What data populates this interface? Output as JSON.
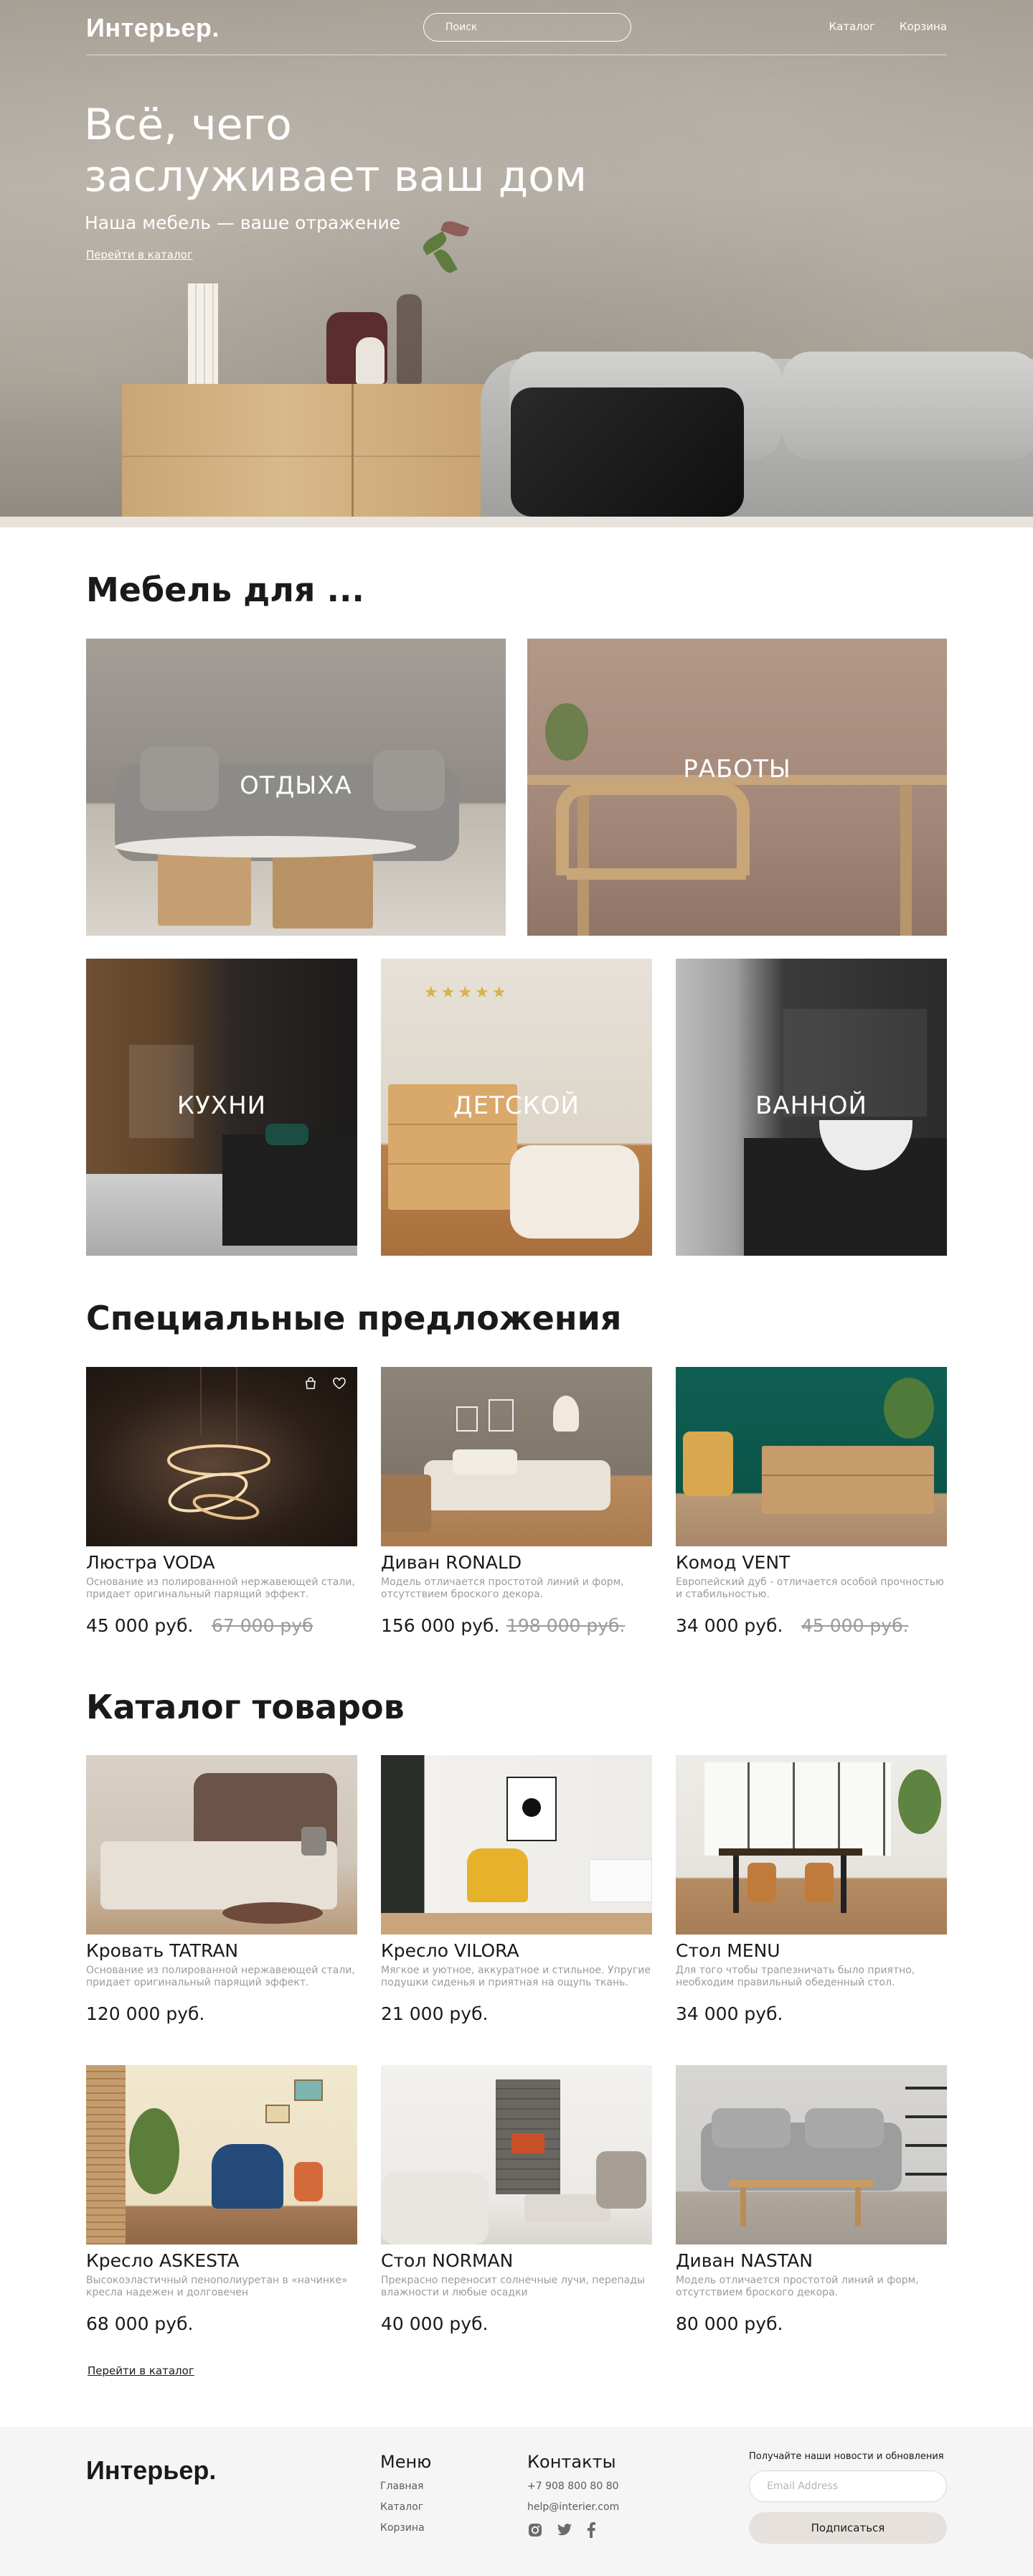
{
  "header": {
    "logo": "Интерьер.",
    "search_placeholder": "Поиск",
    "nav": [
      "Каталог",
      "Корзина"
    ]
  },
  "hero": {
    "title_line1": "Всё, чего",
    "title_line2": "заслуживает ваш дом",
    "subtitle": "Наша мебель — ваше отражение",
    "link": "Перейти в каталог"
  },
  "categories": {
    "title": "Мебель для ...",
    "items": [
      "ОТДЫХА",
      "РАБОТЫ",
      "КУХНИ",
      "ДЕТСКОЙ",
      "ВАННОЙ"
    ]
  },
  "specials": {
    "title": "Специальные предложения",
    "items": [
      {
        "name": "Люстра VODA",
        "desc": "Основание из полированной нержавеющей стали, придает оригинальный парящий эффект.",
        "price": "45 000 руб.",
        "old_price": "67 000 руб"
      },
      {
        "name": "Диван RONALD",
        "desc": "Модель отличается простотой линий и форм, отсутствием броского декора.",
        "price": "156 000 руб.",
        "old_price": "198 000 руб."
      },
      {
        "name": "Комод VENT",
        "desc": "Европейский дуб - отличается особой прочностью и стабильностью.",
        "price": "34 000 руб.",
        "old_price": "45 000 руб."
      }
    ]
  },
  "catalog": {
    "title": "Каталог товаров",
    "items": [
      {
        "name": "Кровать TATRAN",
        "desc": "Основание из полированной нержавеющей стали, придает оригинальный парящий эффект.",
        "price": "120 000 руб."
      },
      {
        "name": "Кресло VILORA",
        "desc": "Мягкое и уютное, аккуратное и стильное. Упругие подушки сиденья и приятная на ощупь ткань.",
        "price": "21 000 руб."
      },
      {
        "name": "Стол MENU",
        "desc": "Для того чтобы трапезничать было приятно, необходим правильный обеденный стол.",
        "price": "34 000 руб."
      },
      {
        "name": "Кресло ASKESTA",
        "desc": "Высокоэластичный пенополиуретан в «начинке» кресла надежен и долговечен",
        "price": "68 000 руб."
      },
      {
        "name": "Стол NORMAN",
        "desc": "Прекрасно переносит солнечные лучи, перепады влажности и любые осадки",
        "price": "40 000 руб."
      },
      {
        "name": "Диван NASTAN",
        "desc": "Модель отличается простотой линий и форм, отсутствием броского декора.",
        "price": "80 000 руб."
      }
    ],
    "link": "Перейти в каталог"
  },
  "footer": {
    "logo": "Интерьер.",
    "menu_title": "Меню",
    "menu": [
      "Главная",
      "Каталог",
      "Корзина"
    ],
    "contacts_title": "Контакты",
    "phone": "+7 908 800 80 80",
    "email": "help@interier.com",
    "socials": [
      "instagram-icon",
      "twitter-icon",
      "facebook-icon"
    ],
    "newsletter_text": "Получайте наши новости и обновления",
    "email_placeholder": "Email Address",
    "subscribe": "Подписаться"
  },
  "colors": {
    "accent_bg": "#e6e1dc",
    "muted_text": "#9b9b9b",
    "footer_bg": "#f5f5f5"
  }
}
